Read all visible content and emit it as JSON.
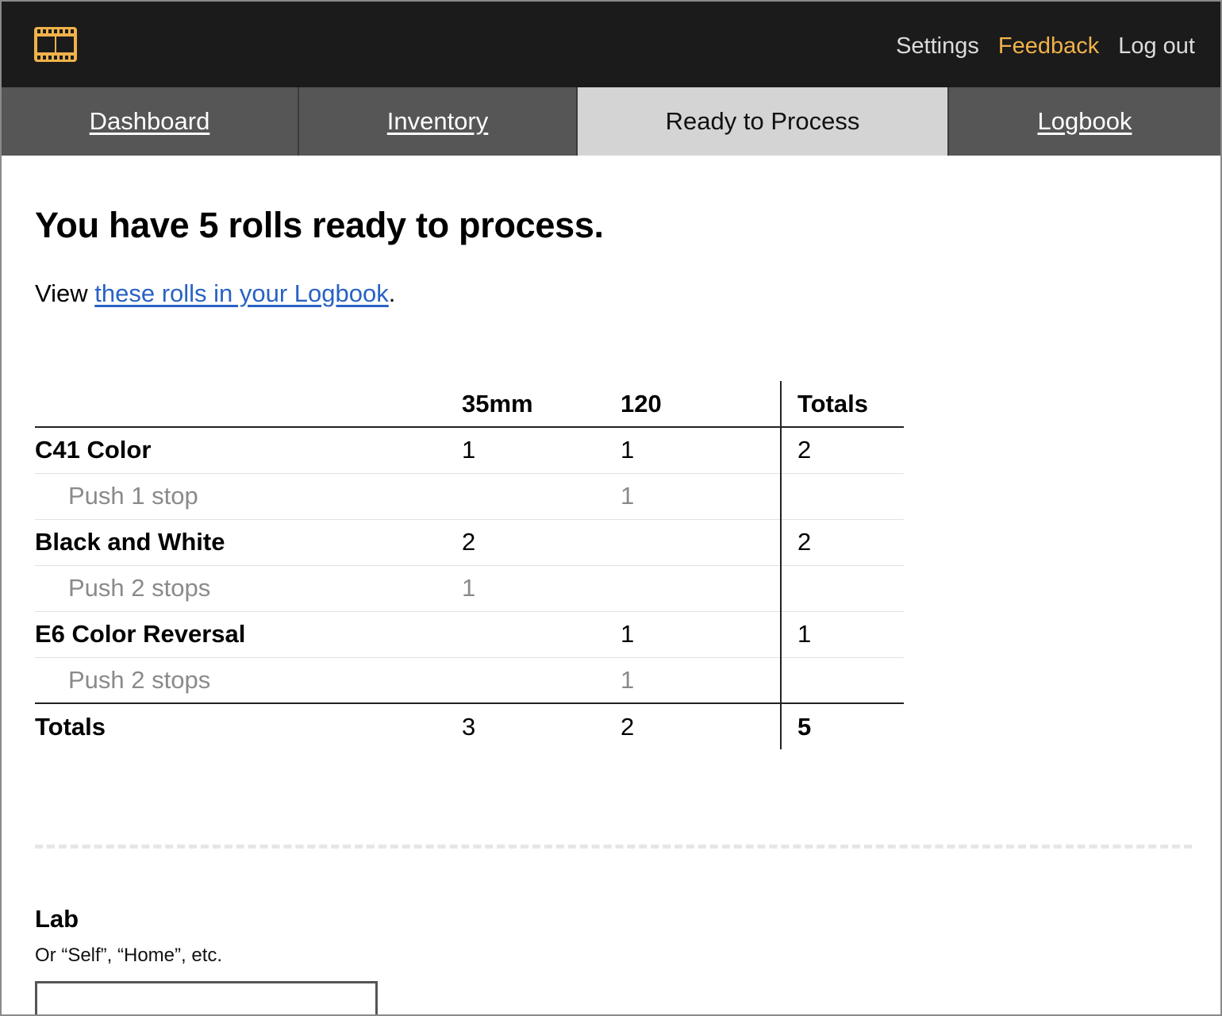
{
  "header": {
    "logo_icon": "film-strip-icon",
    "logo_color": "#f0b24a",
    "links": {
      "settings": "Settings",
      "feedback": "Feedback",
      "logout": "Log out"
    }
  },
  "tabs": [
    {
      "label": "Dashboard",
      "active": false
    },
    {
      "label": "Inventory",
      "active": false
    },
    {
      "label": "Ready to Process",
      "active": true
    },
    {
      "label": "Logbook",
      "active": false
    }
  ],
  "main": {
    "title": "You have 5 rolls ready to process.",
    "view_prefix": "View ",
    "view_link": "these rolls in your Logbook",
    "view_suffix": "."
  },
  "table": {
    "columns": [
      "",
      "",
      "35mm",
      "120",
      "Totals"
    ],
    "rows": [
      {
        "kind": "group",
        "name": "C41 Color",
        "push": "",
        "c35": "1",
        "c120": "1",
        "total": "2"
      },
      {
        "kind": "sub",
        "name": "",
        "push": "Push 1 stop",
        "c35": "",
        "c120": "1",
        "total": ""
      },
      {
        "kind": "group",
        "name": "Black and White",
        "push": "",
        "c35": "2",
        "c120": "",
        "total": "2"
      },
      {
        "kind": "sub",
        "name": "",
        "push": "Push 2 stops",
        "c35": "1",
        "c120": "",
        "total": ""
      },
      {
        "kind": "group",
        "name": "E6 Color Reversal",
        "push": "",
        "c35": "",
        "c120": "1",
        "total": "1"
      },
      {
        "kind": "sub",
        "name": "",
        "push": "Push 2 stops",
        "c35": "",
        "c120": "1",
        "total": ""
      }
    ],
    "totals": {
      "label": "Totals",
      "c35": "3",
      "c120": "2",
      "total": "5"
    }
  },
  "lab": {
    "label": "Lab",
    "hint": "Or “Self”, “Home”, etc.",
    "value": ""
  }
}
